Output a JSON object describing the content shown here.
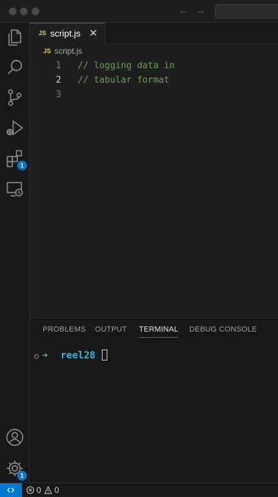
{
  "window": {
    "back_glyph": "←",
    "forward_glyph": "→"
  },
  "activity_bar": {
    "items": [
      {
        "name": "explorer-icon"
      },
      {
        "name": "search-icon"
      },
      {
        "name": "source-control-icon"
      },
      {
        "name": "run-debug-icon"
      },
      {
        "name": "extensions-icon",
        "badge": "1"
      },
      {
        "name": "remote-explorer-icon"
      }
    ],
    "bottom": [
      {
        "name": "account-icon"
      },
      {
        "name": "manage-gear-icon",
        "badge": "1"
      }
    ]
  },
  "editor": {
    "tab": {
      "icon_text": "JS",
      "label": "script.js",
      "close_glyph": "✕"
    },
    "breadcrumb": {
      "icon_text": "JS",
      "label": "script.js"
    },
    "lines": [
      {
        "num": "1",
        "text": "// logging data in"
      },
      {
        "num": "2",
        "text": "// tabular format"
      },
      {
        "num": "3",
        "text": ""
      }
    ],
    "active_line": 2
  },
  "panel": {
    "tabs": [
      "PROBLEMS",
      "OUTPUT",
      "TERMINAL",
      "DEBUG CONSOLE"
    ],
    "active_tab": "TERMINAL",
    "terminal": {
      "arrow": "➜",
      "directory": "reel28"
    }
  },
  "status_bar": {
    "errors": "0",
    "warnings": "0"
  },
  "colors": {
    "accent": "#0078d4",
    "comment": "#6a9955",
    "prompt_arrow": "#23d18b",
    "prompt_dir": "#29b8db",
    "js_badge": "#e8c94c"
  }
}
